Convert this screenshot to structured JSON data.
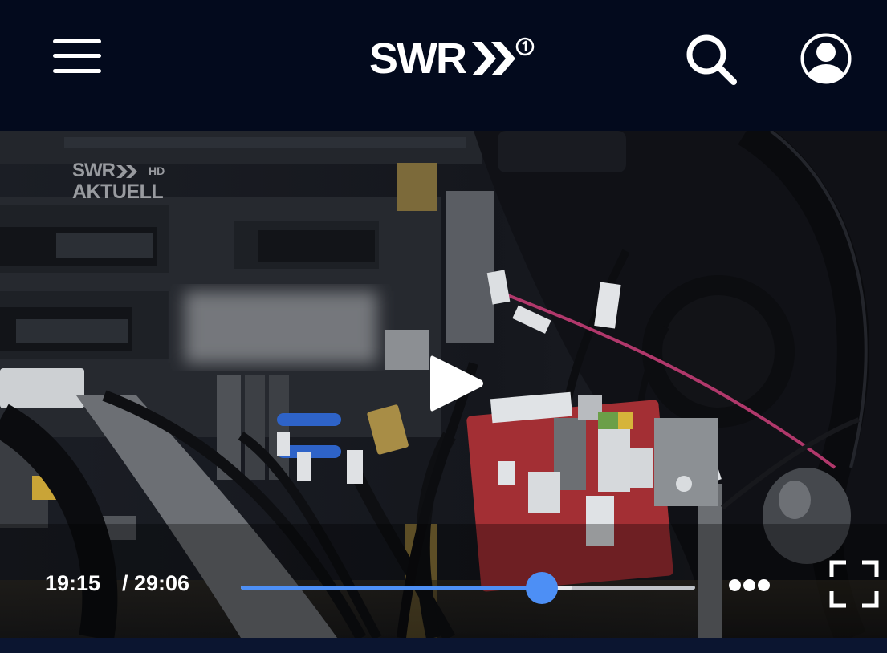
{
  "header": {
    "logo_text": "SWR",
    "logo_icon": "swr-arrows-ard-one-logo",
    "menu_icon": "hamburger-menu-icon",
    "search_icon": "search-icon",
    "account_icon": "user-account-icon"
  },
  "player": {
    "watermark": {
      "line1": "SWR",
      "hd": "HD",
      "line2": "AKTUELL"
    },
    "play_icon": "play-icon",
    "time_current": "19:15",
    "time_total": "/ 29:06",
    "progress_played_fraction": 0.663,
    "progress_buffered_fraction": 0.73,
    "more_icon": "more-dots-icon",
    "fullscreen_icon": "fullscreen-icon"
  },
  "colors": {
    "header_background": "#030a1d",
    "progress_accent": "#4d8ff5",
    "icon_color": "#ffffff"
  }
}
